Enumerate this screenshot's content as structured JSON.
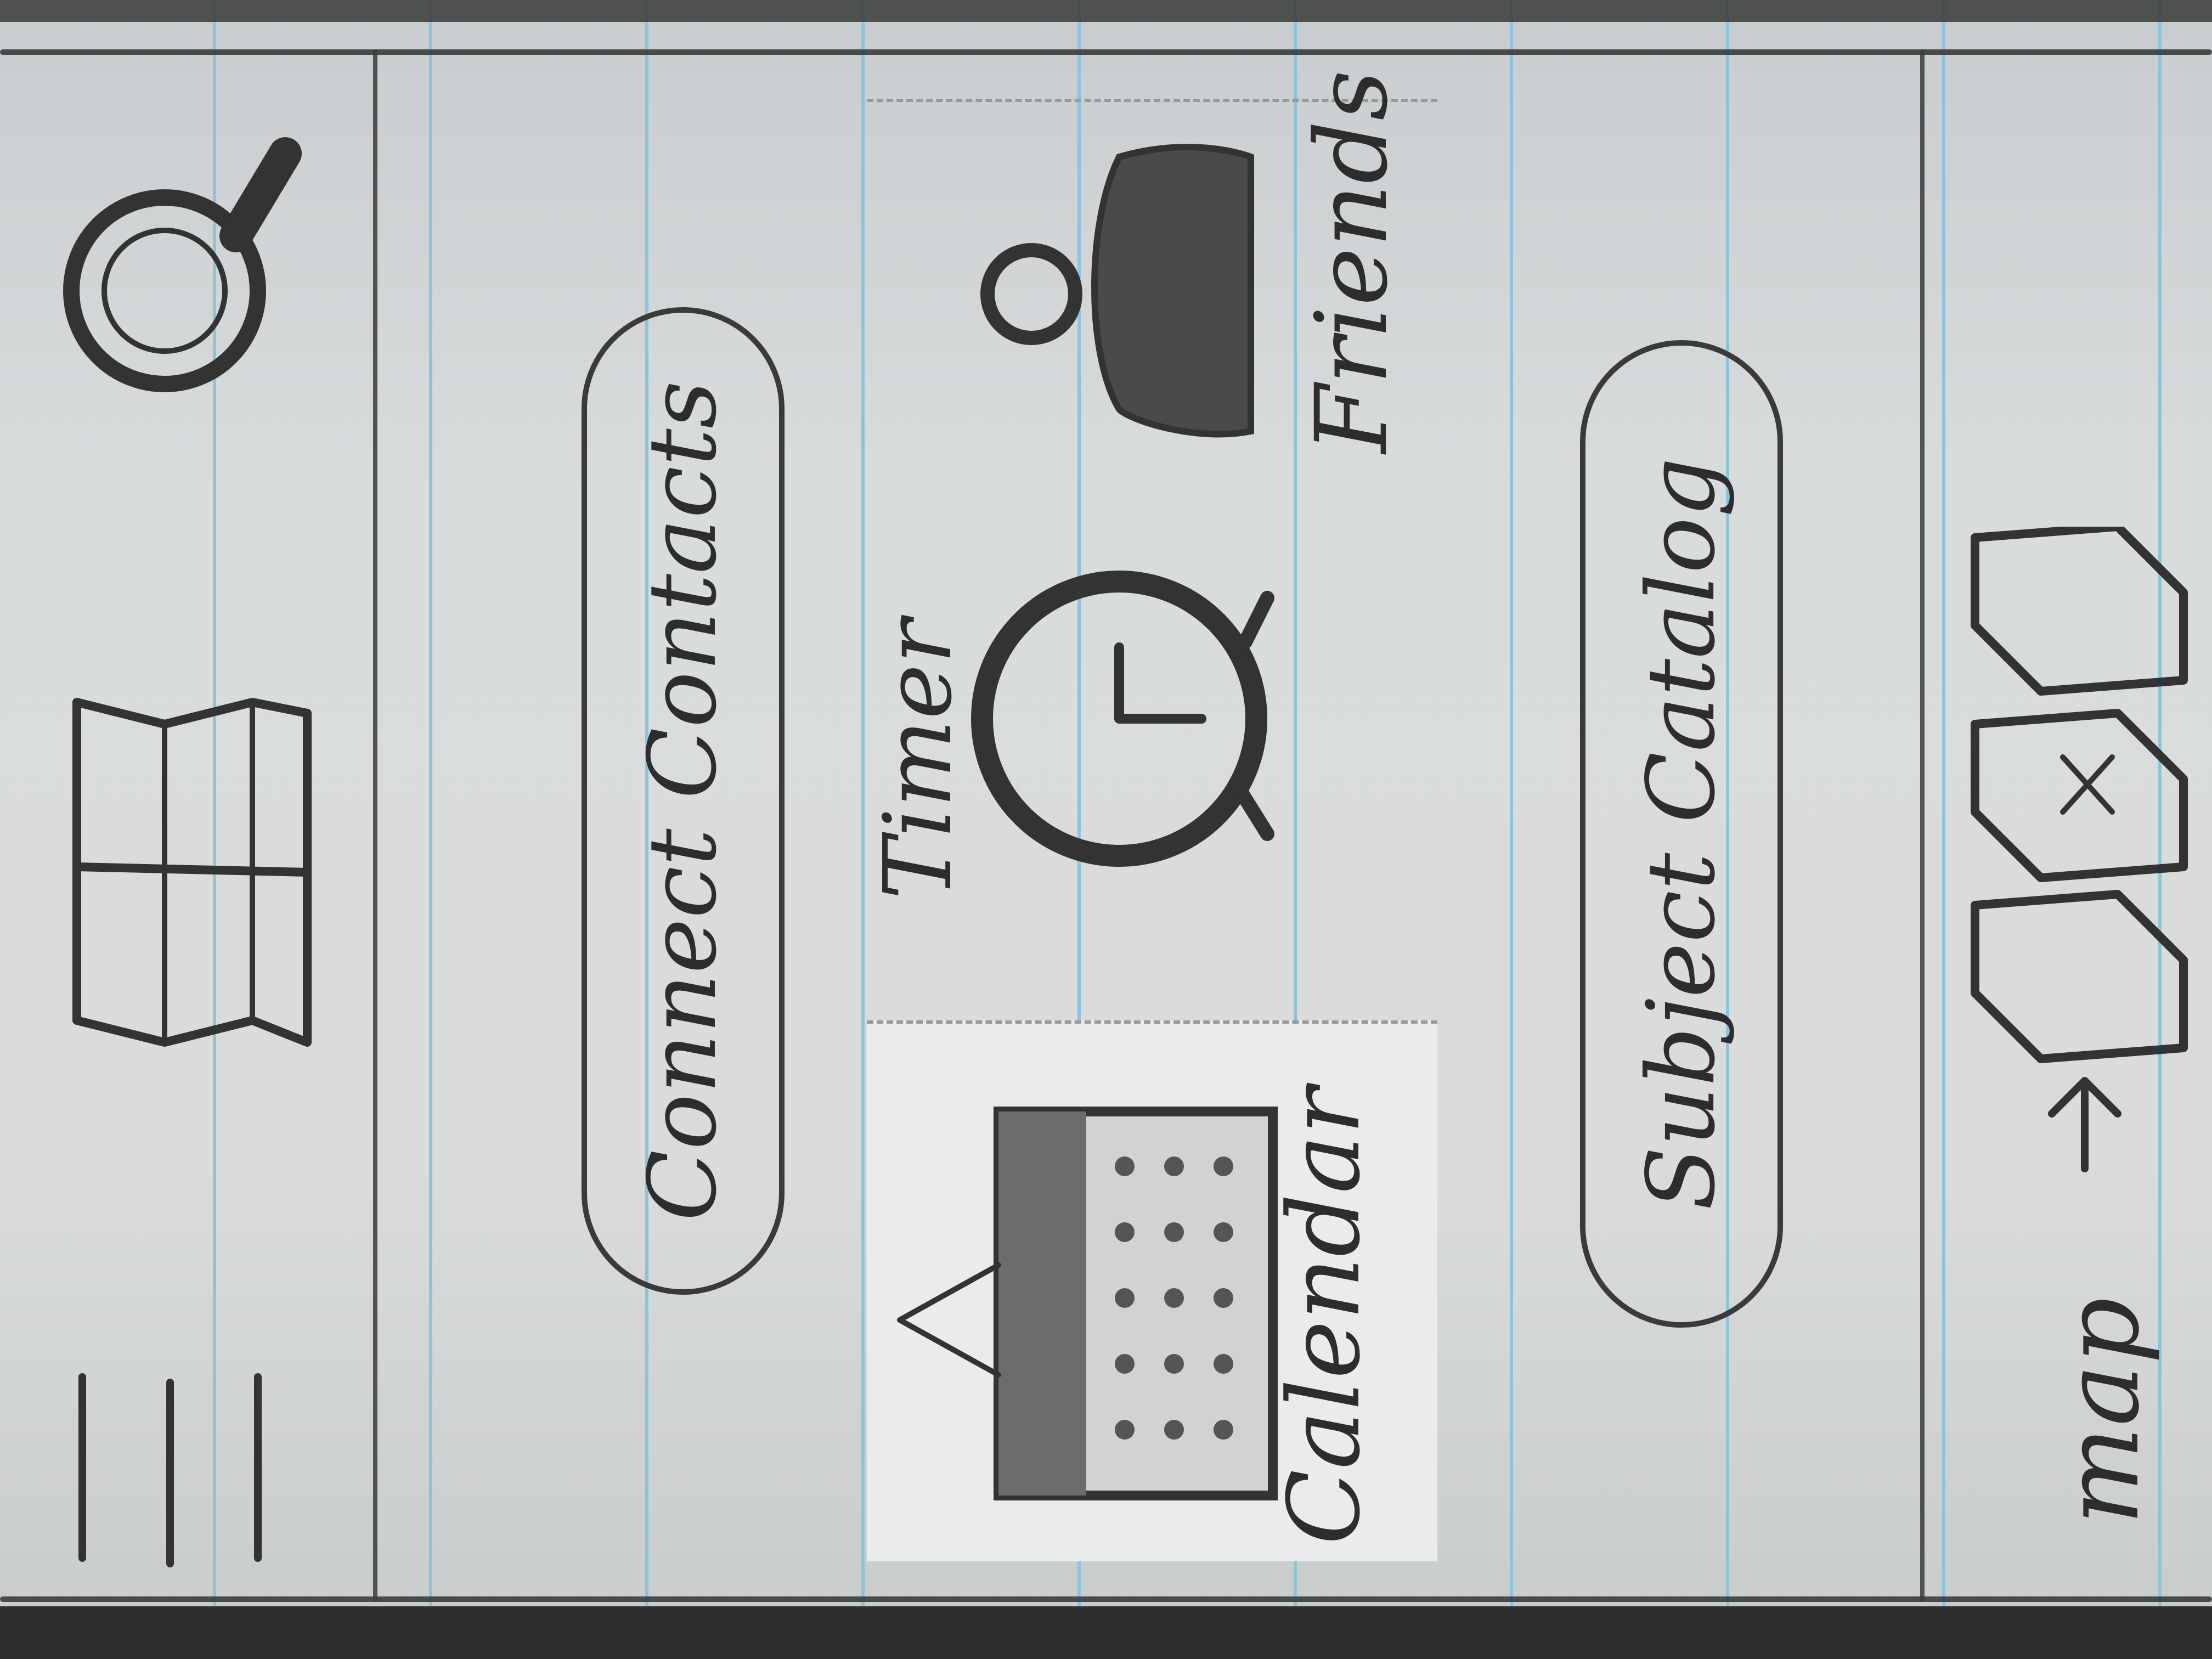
{
  "header": {
    "menu_icon": "hamburger-menu-icon",
    "book_icon": "open-book-icon",
    "search_icon": "search-icon"
  },
  "main": {
    "connect_button_label": "Connect Contacts",
    "tiles": [
      {
        "label": "Calendar",
        "icon": "calendar-icon"
      },
      {
        "label": "Timer",
        "icon": "alarm-clock-icon"
      },
      {
        "label": "Friends",
        "icon": "person-icon"
      }
    ],
    "catalog_button_label": "Subject Catalog"
  },
  "footer": {
    "map_label": "map",
    "map_icon": "folded-map-icon"
  }
}
